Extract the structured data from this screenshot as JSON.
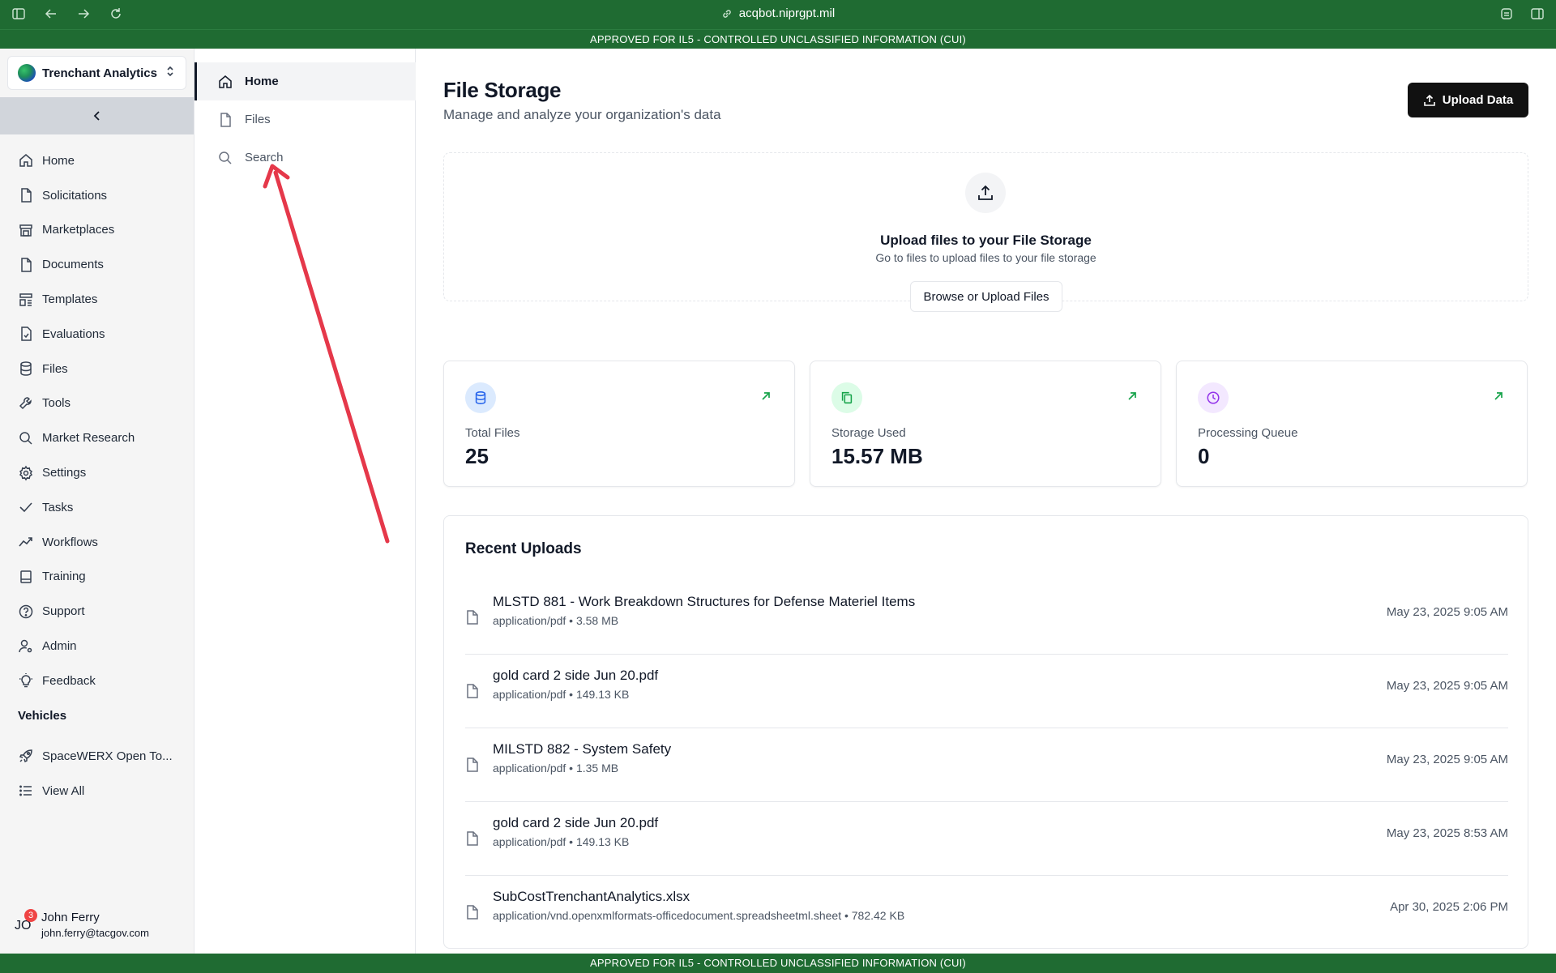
{
  "browser": {
    "url": "acqbot.niprgpt.mil",
    "banner_text": "APPROVED FOR IL5 - CONTROLLED UNCLASSIFIED INFORMATION (CUI)"
  },
  "org": {
    "name": "Trenchant Analytics"
  },
  "sidebar": {
    "items": [
      {
        "label": "Home",
        "icon": "home-icon"
      },
      {
        "label": "Solicitations",
        "icon": "file-icon"
      },
      {
        "label": "Marketplaces",
        "icon": "store-icon"
      },
      {
        "label": "Documents",
        "icon": "document-icon"
      },
      {
        "label": "Templates",
        "icon": "template-icon"
      },
      {
        "label": "Evaluations",
        "icon": "evaluation-icon"
      },
      {
        "label": "Files",
        "icon": "database-icon"
      },
      {
        "label": "Tools",
        "icon": "wrench-icon"
      },
      {
        "label": "Market Research",
        "icon": "search-icon"
      },
      {
        "label": "Settings",
        "icon": "gear-icon"
      },
      {
        "label": "Tasks",
        "icon": "check-icon"
      },
      {
        "label": "Workflows",
        "icon": "trend-icon"
      },
      {
        "label": "Training",
        "icon": "book-icon"
      },
      {
        "label": "Support",
        "icon": "help-circle-icon"
      },
      {
        "label": "Admin",
        "icon": "user-cog-icon"
      },
      {
        "label": "Feedback",
        "icon": "lightbulb-icon"
      }
    ],
    "vehicles_title": "Vehicles",
    "vehicles": [
      {
        "label": "SpaceWERX Open To...",
        "icon": "rocket-icon"
      },
      {
        "label": "View All",
        "icon": "list-icon"
      }
    ]
  },
  "user": {
    "initials": "JO",
    "notification_count": "3",
    "name": "John Ferry",
    "email": "john.ferry@tacgov.com"
  },
  "subnav": {
    "items": [
      {
        "label": "Home",
        "icon": "home-icon",
        "active": true
      },
      {
        "label": "Files",
        "icon": "file-icon",
        "active": false
      },
      {
        "label": "Search",
        "icon": "search-icon",
        "active": false
      }
    ]
  },
  "main": {
    "title": "File Storage",
    "subtitle": "Manage and analyze your organization's data",
    "upload_button": "Upload Data",
    "dropzone": {
      "title": "Upload files to your File Storage",
      "subtitle": "Go to files to upload files to your file storage",
      "button": "Browse or Upload Files"
    },
    "stats": [
      {
        "label": "Total Files",
        "value": "25",
        "icon": "database-icon",
        "color": "#2563eb",
        "bg": "#dbeafe"
      },
      {
        "label": "Storage Used",
        "value": "15.57 MB",
        "icon": "copy-icon",
        "color": "#16a34a",
        "bg": "#dcfce7"
      },
      {
        "label": "Processing Queue",
        "value": "0",
        "icon": "clock-icon",
        "color": "#9333ea",
        "bg": "#f3e8ff"
      }
    ],
    "recent": {
      "title": "Recent Uploads",
      "files": [
        {
          "name": "MLSTD 881 - Work Breakdown Structures for Defense Materiel Items",
          "meta": "application/pdf • 3.58 MB",
          "date": "May 23, 2025 9:05 AM"
        },
        {
          "name": "gold card 2 side Jun 20.pdf",
          "meta": "application/pdf • 149.13 KB",
          "date": "May 23, 2025 9:05 AM"
        },
        {
          "name": "MILSTD 882 - System Safety",
          "meta": "application/pdf • 1.35 MB",
          "date": "May 23, 2025 9:05 AM"
        },
        {
          "name": "gold card 2 side Jun 20.pdf",
          "meta": "application/pdf • 149.13 KB",
          "date": "May 23, 2025 8:53 AM"
        },
        {
          "name": "SubCostTrenchantAnalytics.xlsx",
          "meta": "application/vnd.openxmlformats-officedocument.spreadsheetml.sheet • 782.42 KB",
          "date": "Apr 30, 2025 2:06 PM"
        }
      ]
    }
  },
  "colors": {
    "brand_green": "#1f6b32",
    "annotation_red": "#e5384a"
  }
}
